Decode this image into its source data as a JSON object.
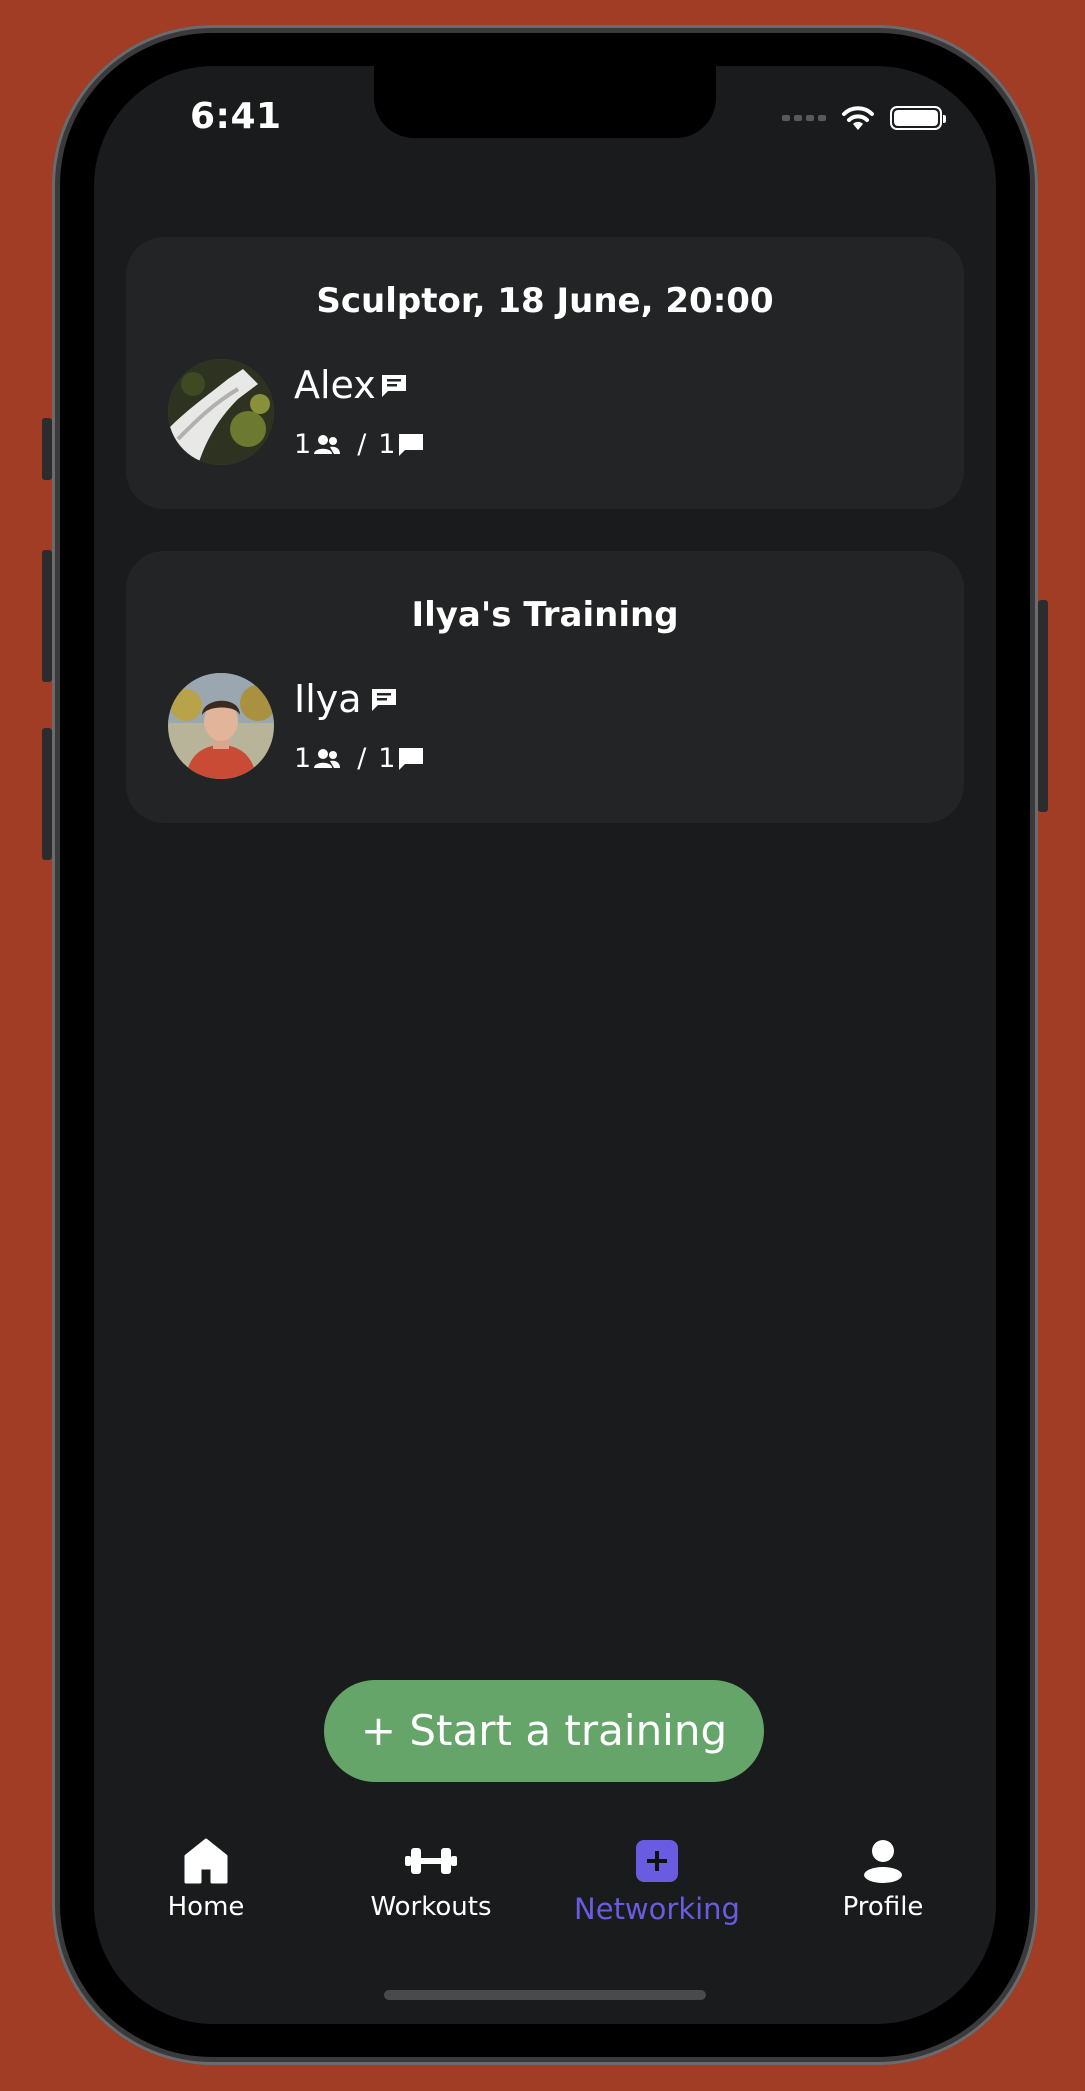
{
  "status_bar": {
    "time": "6:41"
  },
  "sessions": [
    {
      "title": "Sculptor, 18 June, 20:00",
      "host": "Alex",
      "participants": "1",
      "messages": "1",
      "separator": "/"
    },
    {
      "title": "Ilya's Training",
      "host": "Ilya",
      "participants": "1",
      "messages": "1",
      "separator": "/"
    }
  ],
  "start_button": {
    "label": "+ Start a training"
  },
  "tabs": [
    {
      "label": "Home",
      "icon": "home-icon"
    },
    {
      "label": "Workouts",
      "icon": "dumbbell-icon"
    },
    {
      "label": "Networking",
      "icon": "plus-square-icon",
      "active": true
    },
    {
      "label": "Profile",
      "icon": "person-icon"
    }
  ],
  "colors": {
    "background": "#a13c25",
    "screen": "#1a1b1d",
    "card": "#232426",
    "accent": "#6a5ce0",
    "start_button": "#66a56a"
  }
}
